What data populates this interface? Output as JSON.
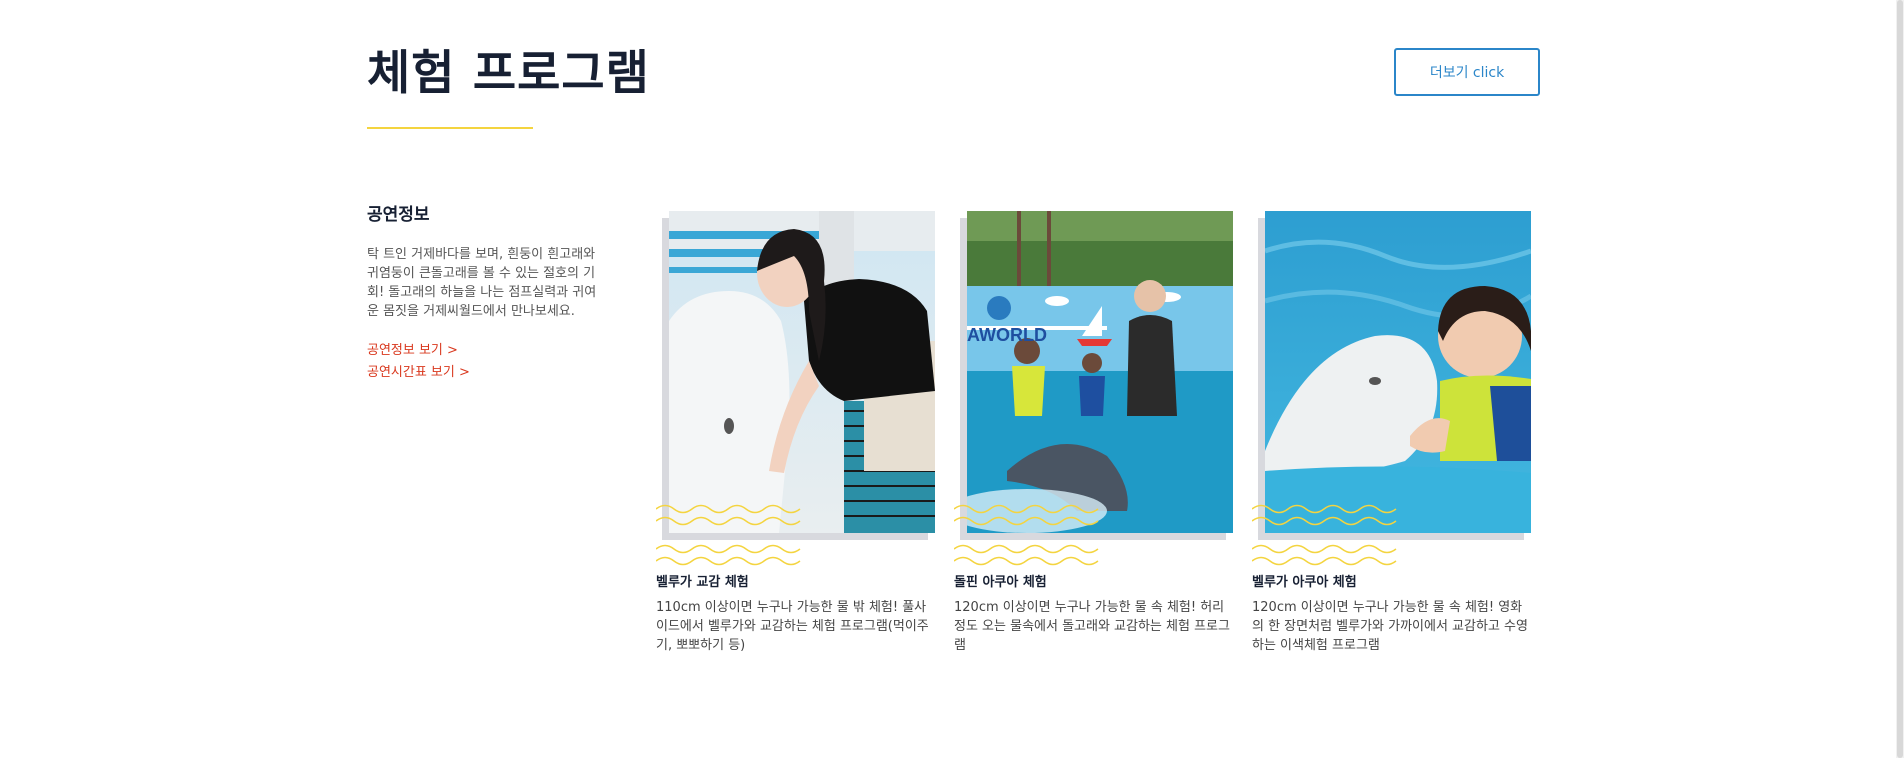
{
  "section": {
    "title": "체험 프로그램",
    "more_button": "더보기 click"
  },
  "info": {
    "heading": "공연정보",
    "description": "탁 트인 거제바다를 보며, 흰둥이 흰고래와 귀염둥이 큰돌고래를 볼 수 있는 절호의 기회! 돌고래의 하늘을 나는 점프실력과 귀여운 몸짓을 거제씨월드에서 만나보세요.",
    "links": [
      "공연정보 보기 >",
      "공연시간표 보기 >"
    ]
  },
  "cards": [
    {
      "title": "벨루가 교감 체험",
      "description": "110cm 이상이면 누구나 가능한 물 밖 체험! 풀사이드에서 벨루가와 교감하는 체험 프로그램(먹이주기, 뽀뽀하기 등)"
    },
    {
      "title": "돌핀 아쿠아 체험",
      "description": "120cm 이상이면 누구나 가능한 물 속 체험! 허리정도 오는 물속에서 돌고래와 교감하는 체험 프로그램",
      "photo_sign": "AWORLD"
    },
    {
      "title": "벨루가 아쿠아 체험",
      "description": "120cm 이상이면 누구나 가능한 물 속 체험! 영화의 한 장면처럼 벨루가와 가까이에서 교감하고 수영하는 이색체험 프로그램"
    }
  ],
  "colors": {
    "title": "#172033",
    "accent_yellow": "#f4d43f",
    "button_blue": "#2b86c9",
    "link_red": "#d9381e"
  }
}
